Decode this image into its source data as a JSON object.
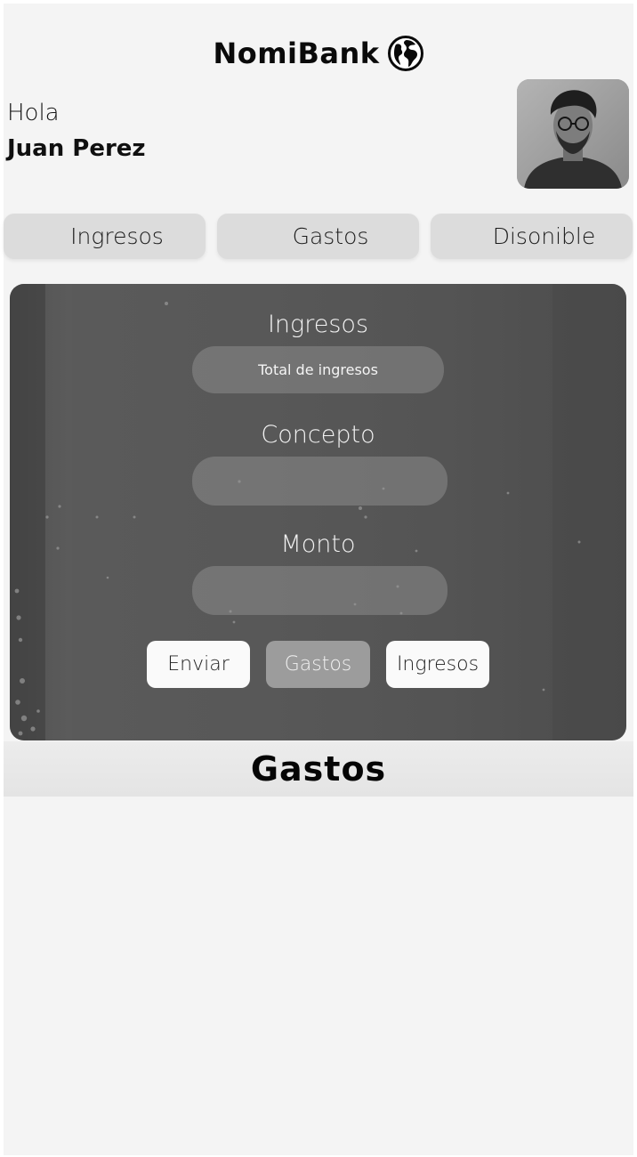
{
  "header": {
    "brand": "NomiBank",
    "brand_icon": "globe-icon"
  },
  "user": {
    "greeting": "Hola",
    "name": "Juan Perez",
    "avatar": "avatar-photo"
  },
  "tabs": [
    {
      "label": "Ingresos"
    },
    {
      "label": "Gastos"
    },
    {
      "label": "Disonible"
    }
  ],
  "form": {
    "title": "Ingresos",
    "total_placeholder": "Total de ingresos",
    "concepto_label": "Concepto",
    "concepto_value": "",
    "monto_label": "Monto",
    "monto_value": "",
    "buttons": {
      "enviar": "Enviar",
      "gastos": "Gastos",
      "ingresos": "Ingresos"
    }
  },
  "section": {
    "title": "Gastos"
  },
  "colors": {
    "background": "#f4f4f4",
    "card": "#555555",
    "tab": "#dcdcdc",
    "button_light": "#fafafa",
    "button_active": "#9c9c9c"
  }
}
